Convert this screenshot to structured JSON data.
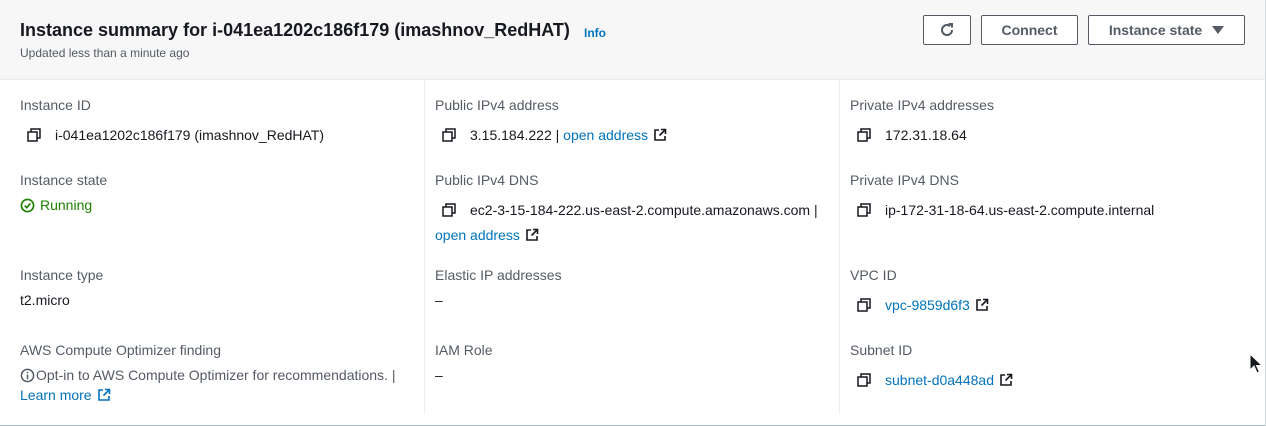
{
  "header": {
    "title": "Instance summary for i-041ea1202c186f179 (imashnov_RedHAT)",
    "info_label": "Info",
    "updated_text": "Updated less than a minute ago",
    "connect_label": "Connect",
    "instance_state_label": "Instance state"
  },
  "fields": {
    "instance_id": {
      "label": "Instance ID",
      "value": "i-041ea1202c186f179 (imashnov_RedHAT)"
    },
    "public_ipv4": {
      "label": "Public IPv4 address",
      "value": "3.15.184.222",
      "separator": " | ",
      "link": "open address"
    },
    "private_ipv4": {
      "label": "Private IPv4 addresses",
      "value": "172.31.18.64"
    },
    "instance_state": {
      "label": "Instance state",
      "value": "Running"
    },
    "public_dns": {
      "label": "Public IPv4 DNS",
      "value": "ec2-3-15-184-222.us-east-2.compute.amazonaws.com |",
      "link": "open address"
    },
    "private_dns": {
      "label": "Private IPv4 DNS",
      "value": "ip-172-31-18-64.us-east-2.compute.internal"
    },
    "instance_type": {
      "label": "Instance type",
      "value": "t2.micro"
    },
    "elastic_ip": {
      "label": "Elastic IP addresses",
      "value": "–"
    },
    "vpc_id": {
      "label": "VPC ID",
      "value": "vpc-9859d6f3"
    },
    "optimizer": {
      "label": "AWS Compute Optimizer finding",
      "value": "Opt-in to AWS Compute Optimizer for recommendations. |",
      "link": "Learn more"
    },
    "iam_role": {
      "label": "IAM Role",
      "value": "–"
    },
    "subnet_id": {
      "label": "Subnet ID",
      "value": "subnet-d0a448ad"
    }
  },
  "colors": {
    "link": "#0073bb",
    "running": "#1d8102",
    "label": "#545b64"
  },
  "icons": [
    "refresh-icon",
    "caret-down-icon",
    "copy-icon",
    "external-link-icon",
    "check-circle-icon",
    "info-circle-icon",
    "mouse-cursor-icon"
  ]
}
